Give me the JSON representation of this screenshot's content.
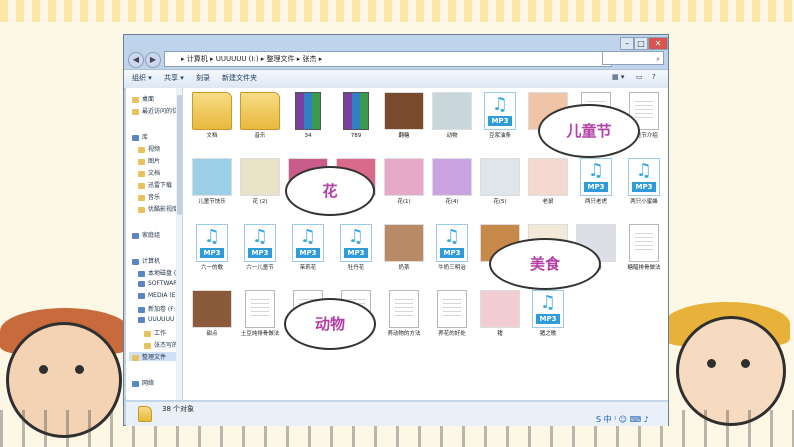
{
  "window": {
    "address_path": "▸ 计算机 ▸ UUUUUU (I:) ▸ 整理文件 ▸ 张杰 ▸",
    "search_icon": "⌕",
    "toolbar": {
      "organize": "组织 ▾",
      "share": "共享 ▾",
      "burn": "刻录",
      "new_folder": "新建文件夹"
    },
    "status_count": "38 个对象"
  },
  "sidebar": {
    "items": [
      {
        "label": "桌面"
      },
      {
        "label": "最近访问的位置"
      },
      {
        "label": "库"
      },
      {
        "label": "视频"
      },
      {
        "label": "图片"
      },
      {
        "label": "文档"
      },
      {
        "label": "迅雷下载"
      },
      {
        "label": "音乐"
      },
      {
        "label": "优酷影视库"
      },
      {
        "label": "家庭组"
      },
      {
        "label": "计算机"
      },
      {
        "label": "本地磁盘 (C"
      },
      {
        "label": "SOFTWARE"
      },
      {
        "label": "MEDIA (E:)"
      },
      {
        "label": "新加卷 (F:)"
      },
      {
        "label": "UUUUUU (I"
      },
      {
        "label": "工作"
      },
      {
        "label": "张杰写的"
      },
      {
        "label": "整理文件"
      },
      {
        "label": "网络"
      }
    ]
  },
  "files": [
    {
      "label": "文档",
      "type": "folder"
    },
    {
      "label": "音乐",
      "type": "folder"
    },
    {
      "label": "34",
      "type": "rar"
    },
    {
      "label": "789",
      "type": "rar"
    },
    {
      "label": "翻糖",
      "type": "photo",
      "color": "#7a4a2c"
    },
    {
      "label": "动物",
      "type": "photo",
      "color": "#c9d6de"
    },
    {
      "label": "豆浆油条",
      "type": "mp3"
    },
    {
      "label": "儿童",
      "type": "photo",
      "color": "#f0c4a6"
    },
    {
      "label": "",
      "type": "doc"
    },
    {
      "label": "儿童节介绍",
      "type": "doc"
    },
    {
      "label": "儿童节快乐",
      "type": "photo",
      "color": "#9ccfe8"
    },
    {
      "label": "花 (2)",
      "type": "photo",
      "color": "#e9e2c6"
    },
    {
      "label": "",
      "type": "photo",
      "color": "#c95c8a"
    },
    {
      "label": "花 (6)",
      "type": "photo",
      "color": "#d96a8c"
    },
    {
      "label": "花(1)",
      "type": "photo",
      "color": "#e7a9c9"
    },
    {
      "label": "花(4)",
      "type": "photo",
      "color": "#c9a4e0"
    },
    {
      "label": "花(5)",
      "type": "photo",
      "color": "#dfe6e9"
    },
    {
      "label": "老鼠",
      "type": "photo",
      "color": "#f3d9d0"
    },
    {
      "label": "两只老虎",
      "type": "mp3"
    },
    {
      "label": "两只小蜜蜂",
      "type": "mp3"
    },
    {
      "label": "六一的歌",
      "type": "mp3"
    },
    {
      "label": "六一儿童节",
      "type": "mp3"
    },
    {
      "label": "茉莉花",
      "type": "mp3"
    },
    {
      "label": "牡丹花",
      "type": "mp3"
    },
    {
      "label": "奶茶",
      "type": "photo",
      "color": "#b98a66"
    },
    {
      "label": "牛奶三明治",
      "type": "mp3"
    },
    {
      "label": "",
      "type": "photo",
      "color": "#c88a4a"
    },
    {
      "label": "",
      "type": "photo",
      "color": "#f2e9d8"
    },
    {
      "label": "酸奶",
      "type": "photo",
      "color": "#dcdfe6"
    },
    {
      "label": "糖醋排骨做法",
      "type": "doc"
    },
    {
      "label": "甜点",
      "type": "photo",
      "color": "#8a5a3a"
    },
    {
      "label": "土豆炖排骨做法",
      "type": "doc"
    },
    {
      "label": "",
      "type": "doc"
    },
    {
      "label": "",
      "type": "doc"
    },
    {
      "label": "养动物的方法",
      "type": "doc"
    },
    {
      "label": "养花的好处",
      "type": "doc"
    },
    {
      "label": "猪",
      "type": "photo",
      "color": "#f1cdd2"
    },
    {
      "label": "猪之歌",
      "type": "mp3"
    }
  ],
  "mp3_tag": "MP3",
  "clouds": {
    "children_day": "儿童节",
    "flowers": "花",
    "food": "美食",
    "animals": "动物"
  }
}
